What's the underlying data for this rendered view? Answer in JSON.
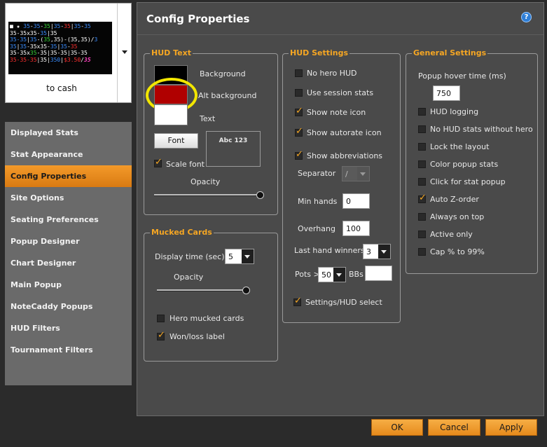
{
  "profile": {
    "name": "to cash",
    "hud_preview": [
      [
        [
          "c-w",
          "■ "
        ],
        [
          "c-w",
          "★ "
        ],
        [
          "c-b",
          "35"
        ],
        [
          "c-w",
          "-"
        ],
        [
          "c-b",
          "35"
        ],
        [
          "c-w",
          "-"
        ],
        [
          "c-g",
          "35"
        ],
        [
          "c-w",
          "|"
        ],
        [
          "c-b",
          "35"
        ],
        [
          "c-w",
          "-"
        ],
        [
          "c-r",
          "35"
        ],
        [
          "c-w",
          "|"
        ],
        [
          "c-b",
          "35"
        ],
        [
          "c-w",
          "-"
        ],
        [
          "c-b",
          "35"
        ]
      ],
      [
        [
          "c-w",
          "35-35x35-"
        ],
        [
          "c-b",
          "35"
        ],
        [
          "c-w",
          "|35"
        ]
      ],
      [
        [
          "c-b",
          "35-35"
        ],
        [
          "c-w",
          "|"
        ],
        [
          "c-b",
          "35"
        ],
        [
          "c-w",
          "-("
        ],
        [
          "c-g",
          "35"
        ],
        [
          "c-w",
          ","
        ],
        [
          "c-w",
          "35)"
        ],
        [
          "c-w",
          "-(35,35)/"
        ],
        [
          "c-b",
          "3"
        ]
      ],
      [
        [
          "c-b",
          "35"
        ],
        [
          "c-w",
          "|"
        ],
        [
          "c-b",
          "35"
        ],
        [
          "c-w",
          "-35x35-"
        ],
        [
          "c-b",
          "35"
        ],
        [
          "c-w",
          "|"
        ],
        [
          "c-b",
          "35"
        ],
        [
          "c-w",
          "-"
        ],
        [
          "c-r",
          "35"
        ]
      ],
      [
        [
          "c-w",
          "35-35x"
        ],
        [
          "c-g",
          "35"
        ],
        [
          "c-w",
          "-35|35-35|35-35"
        ]
      ],
      [
        [
          "c-r",
          "35-35-35"
        ],
        [
          "c-w",
          "|35|"
        ],
        [
          "c-b",
          "350"
        ],
        [
          "c-w",
          "|"
        ],
        [
          "c-r",
          "$3.50"
        ],
        [
          "c-w",
          "/"
        ],
        [
          "c-m",
          "35"
        ]
      ]
    ]
  },
  "nav": {
    "items": [
      {
        "label": "Displayed Stats",
        "active": false
      },
      {
        "label": "Stat Appearance",
        "active": false
      },
      {
        "label": "Config Properties",
        "active": true
      },
      {
        "label": "Site Options",
        "active": false
      },
      {
        "label": "Seating Preferences",
        "active": false
      },
      {
        "label": "Popup Designer",
        "active": false
      },
      {
        "label": "Chart Designer",
        "active": false
      },
      {
        "label": "Main Popup",
        "active": false
      },
      {
        "label": "NoteCaddy Popups",
        "active": false
      },
      {
        "label": "HUD Filters",
        "active": false
      },
      {
        "label": "Tournament Filters",
        "active": false
      }
    ]
  },
  "panel": {
    "title": "Config Properties",
    "help": "?"
  },
  "hud_text": {
    "title": "HUD Text",
    "background_label": "Background",
    "alt_background_label": "Alt background",
    "text_label": "Text",
    "font_button": "Font",
    "font_preview": "Abc 123",
    "scale_font_label": "Scale font",
    "scale_font": true,
    "opacity_label": "Opacity",
    "opacity": 1.0,
    "colors": {
      "background": "#000000",
      "alt_background": "#b00000",
      "text": "#ffffff",
      "highlight": "#f2e600"
    }
  },
  "mucked_cards": {
    "title": "Mucked Cards",
    "display_time_label": "Display time (sec)",
    "display_time": "5",
    "opacity_label": "Opacity",
    "opacity": 1.0,
    "hero_mucked_label": "Hero mucked cards",
    "hero_mucked": false,
    "won_loss_label": "Won/loss label",
    "won_loss": true
  },
  "hud_settings": {
    "title": "HUD Settings",
    "checks": [
      {
        "label": "No hero HUD",
        "checked": false
      },
      {
        "label": "Use session stats",
        "checked": false
      },
      {
        "label": "Show note icon",
        "checked": true
      },
      {
        "label": "Show autorate icon",
        "checked": true
      },
      {
        "label": "Show abbreviations",
        "checked": true
      }
    ],
    "separator_label": "Separator",
    "separator": "/",
    "min_hands_label": "Min hands",
    "min_hands": "0",
    "overhang_label": "Overhang",
    "overhang": "100",
    "last_hand_winners_label": "Last hand winners",
    "last_hand_winners": "3",
    "pots_label": "Pots >",
    "pots": "50",
    "bbs_label": "BBs",
    "bbs_value": "",
    "settings_select_label": "Settings/HUD select",
    "settings_select": true
  },
  "general_settings": {
    "title": "General Settings",
    "popup_hover_label": "Popup hover time (ms)",
    "popup_hover": "750",
    "checks": [
      {
        "label": "HUD logging",
        "checked": false
      },
      {
        "label": "No HUD stats without hero",
        "checked": false
      },
      {
        "label": "Lock the layout",
        "checked": false
      },
      {
        "label": "Color popup stats",
        "checked": false
      },
      {
        "label": "Click for stat popup",
        "checked": false
      },
      {
        "label": "Auto Z-order",
        "checked": true
      },
      {
        "label": "Always on top",
        "checked": false
      },
      {
        "label": "Active only",
        "checked": false
      },
      {
        "label": "Cap % to 99%",
        "checked": false
      }
    ]
  },
  "buttons": {
    "ok": "OK",
    "cancel": "Cancel",
    "apply": "Apply"
  }
}
